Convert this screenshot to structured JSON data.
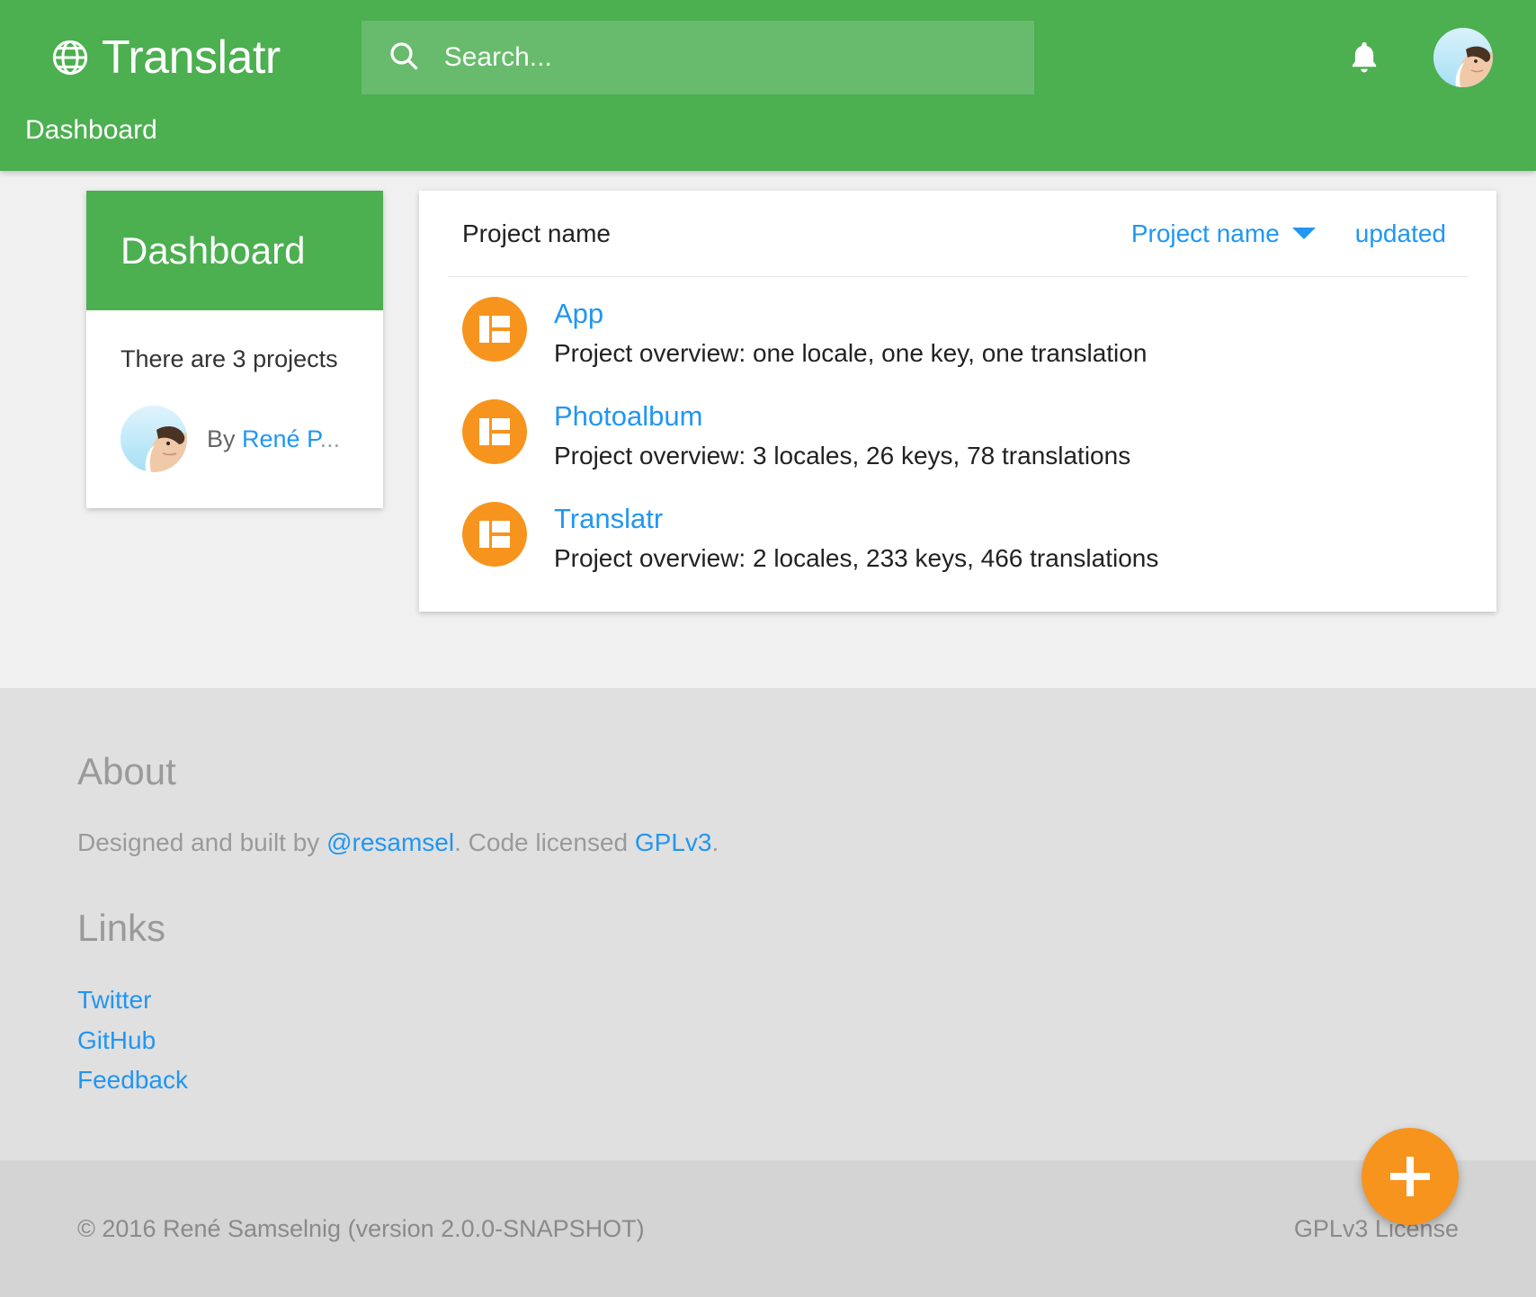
{
  "header": {
    "brand_title": "Translatr",
    "brand_icon": "globe-icon",
    "search_placeholder": "Search...",
    "search_value": "",
    "search_icon": "search-icon",
    "notifications_icon": "bell-icon",
    "avatar_label": "avatar",
    "breadcrumb": "Dashboard",
    "accent_color": "#4caf50"
  },
  "side_card": {
    "title": "Dashboard",
    "summary": "There are 3 projects",
    "by_label": "By",
    "author_name": "René P",
    "author_ellipsis": "..."
  },
  "projects_panel": {
    "column_label": "Project name",
    "sort_active_label": "Project name",
    "sort_caret_icon": "chevron-down-icon",
    "sort_other_label": "updated",
    "rows": [
      {
        "icon": "dashboard-grid-icon",
        "name": "App",
        "description": "Project overview: one locale, one key, one translation"
      },
      {
        "icon": "dashboard-grid-icon",
        "name": "Photoalbum",
        "description": "Project overview: 3 locales, 26 keys, 78 translations"
      },
      {
        "icon": "dashboard-grid-icon",
        "name": "Translatr",
        "description": "Project overview: 2 locales, 233 keys, 466 translations"
      }
    ]
  },
  "footer": {
    "about_heading": "About",
    "about_prefix": "Designed and built by ",
    "about_author": "@resamsel",
    "about_middle": ". Code licensed ",
    "about_license": "GPLv3",
    "about_suffix": ".",
    "links_heading": "Links",
    "links": [
      {
        "label": "Twitter"
      },
      {
        "label": "GitHub"
      },
      {
        "label": "Feedback"
      }
    ],
    "copyright": "© 2016 René Samselnig (version 2.0.0-SNAPSHOT)",
    "license_label": "GPLv3 License",
    "fab_icon": "plus-icon",
    "fab_color": "#f7941e"
  }
}
